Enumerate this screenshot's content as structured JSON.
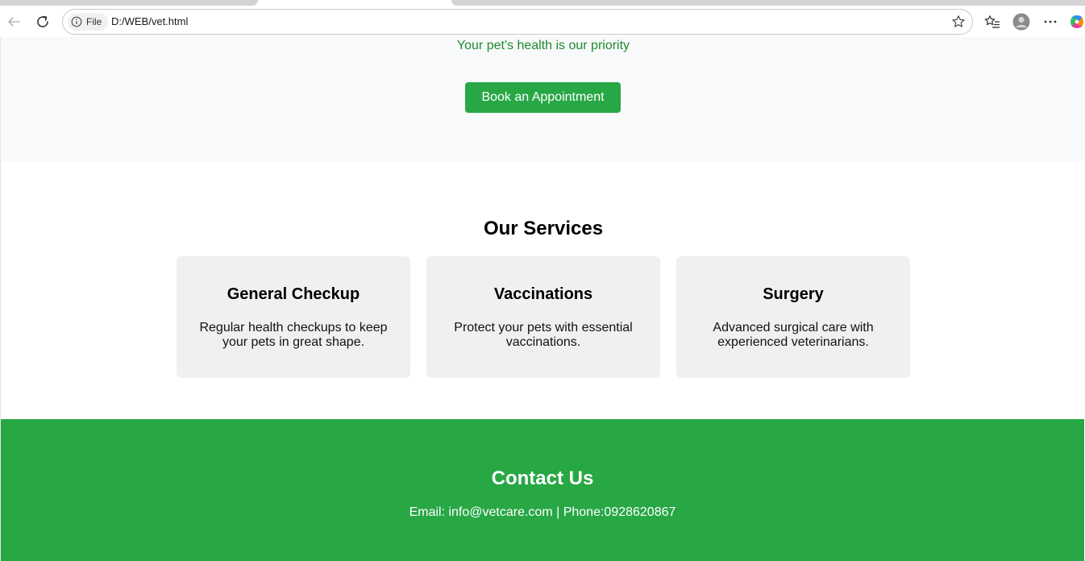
{
  "browser": {
    "address_chip": "File",
    "url": "D:/WEB/vet.html"
  },
  "hero": {
    "tagline": "Your pet's health is our priority",
    "cta_label": "Book an Appointment"
  },
  "services": {
    "title": "Our Services",
    "cards": [
      {
        "title": "General Checkup",
        "description": "Regular health checkups to keep your pets in great shape."
      },
      {
        "title": "Vaccinations",
        "description": "Protect your pets with essential vaccinations."
      },
      {
        "title": "Surgery",
        "description": "Advanced surgical care with experienced veterinarians."
      }
    ]
  },
  "footer": {
    "title": "Contact Us",
    "contact_line": "Email: info@vetcare.com | Phone:0928620867"
  },
  "colors": {
    "brand_green": "#28a745",
    "tagline_green": "#1e8a2e",
    "hero_bg": "#f8f9fa",
    "card_bg": "#f0f0f0"
  },
  "icons": [
    "back-arrow-icon",
    "refresh-icon",
    "info-icon",
    "star-icon",
    "favorites-icon",
    "profile-icon",
    "more-icon",
    "copilot-icon"
  ]
}
